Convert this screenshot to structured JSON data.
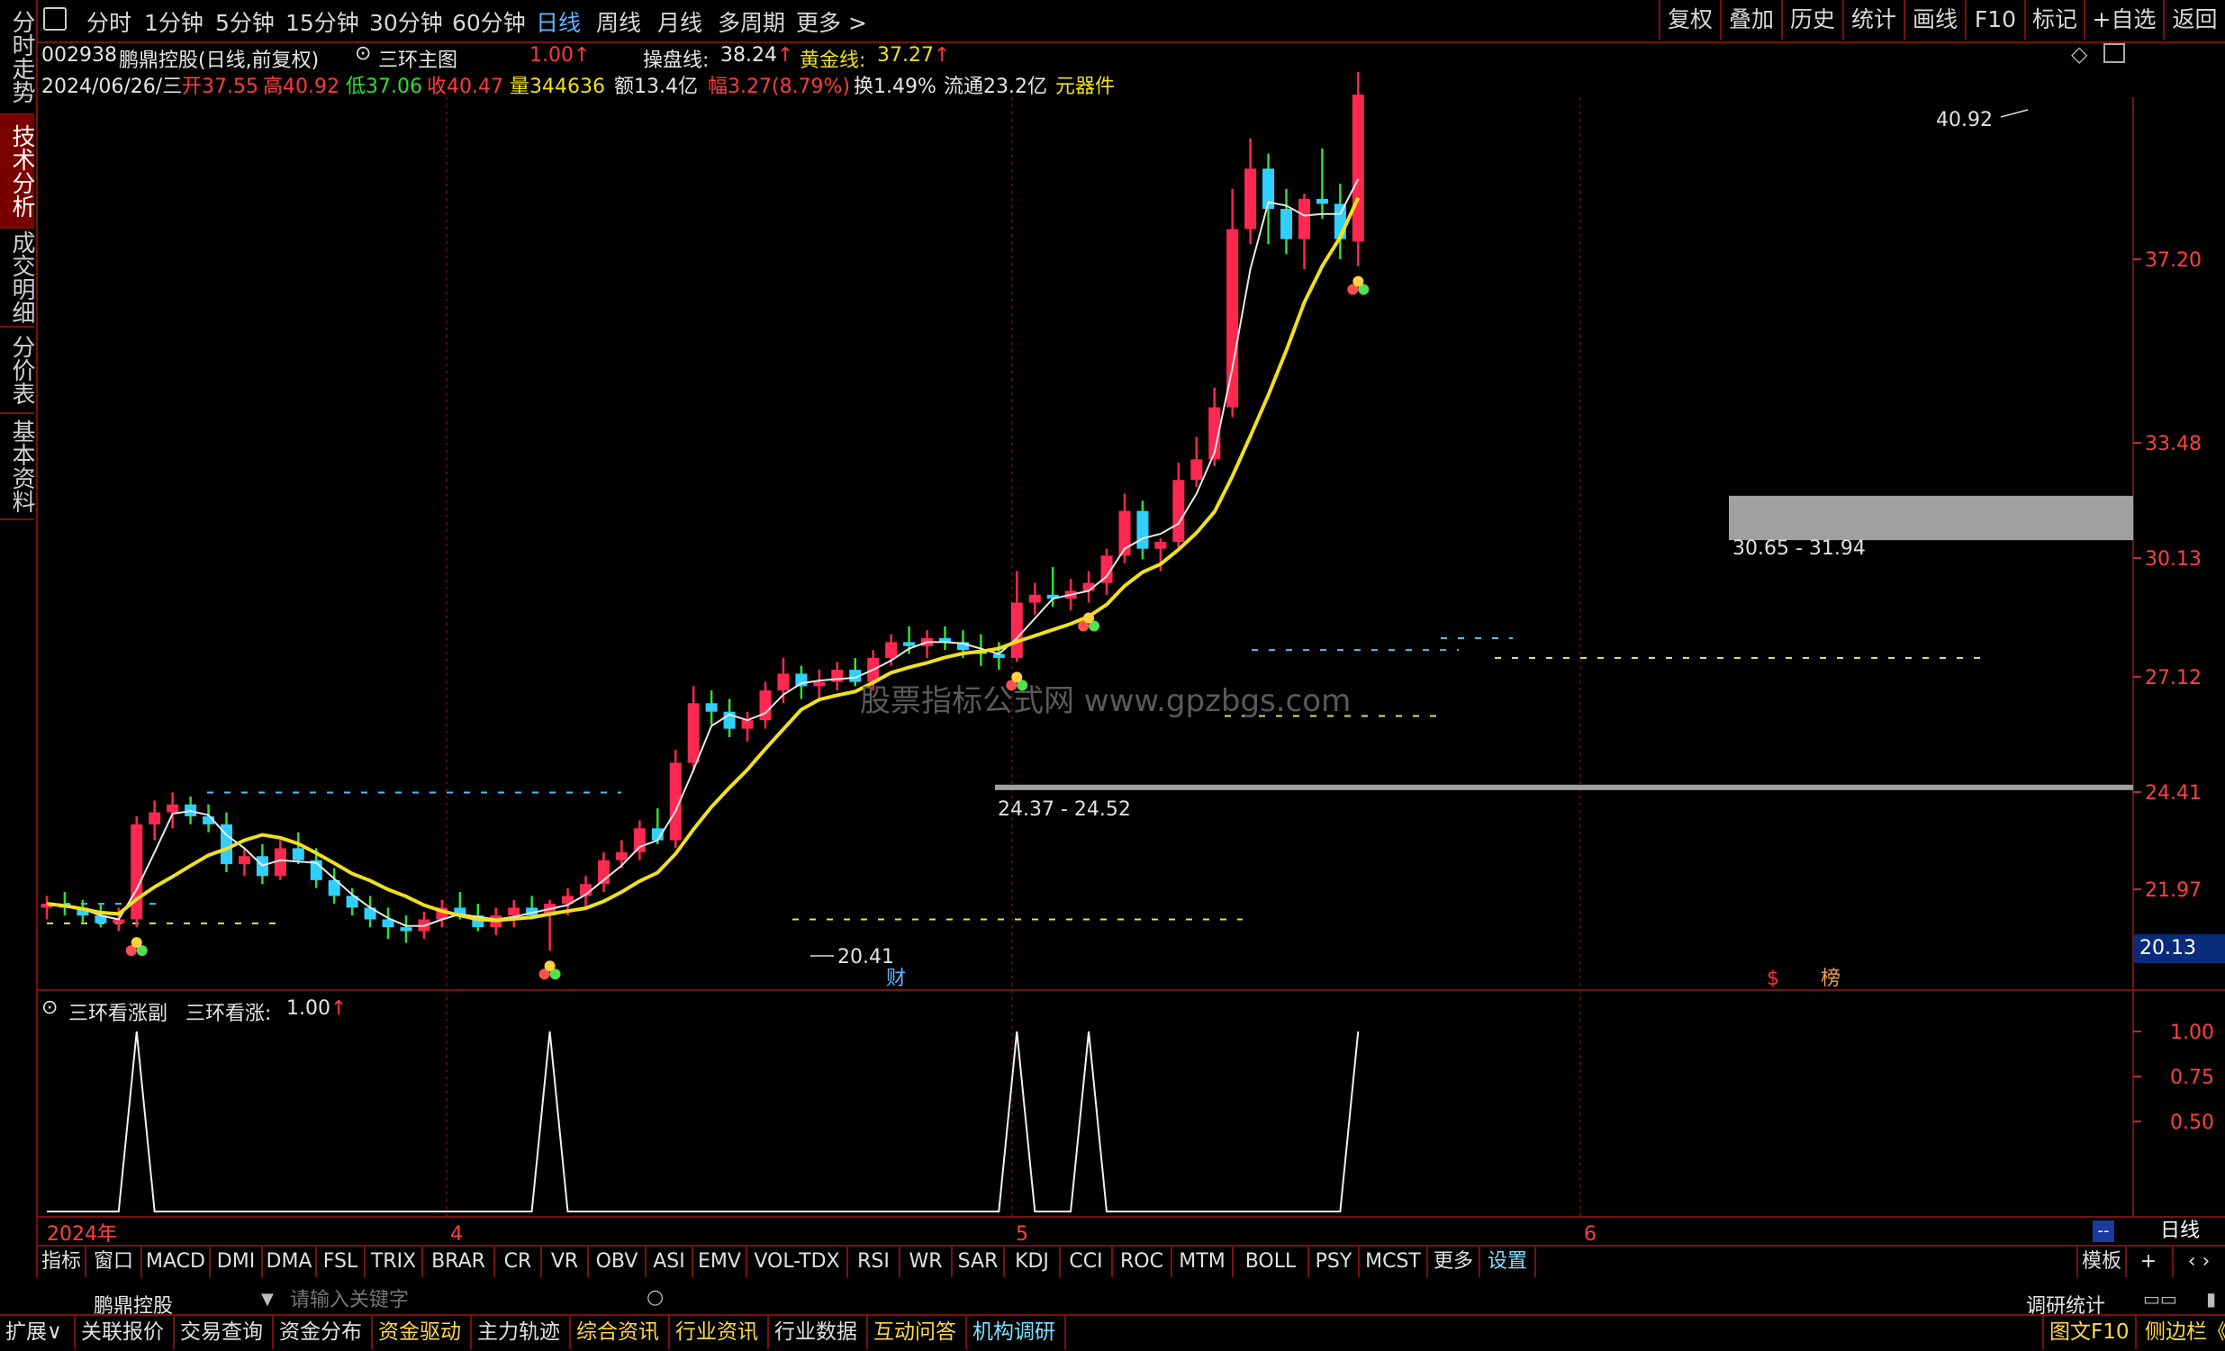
{
  "left_tabs": [
    "分时走势",
    "技术分析",
    "成交明细",
    "分价表",
    "基本资料"
  ],
  "active_left_tab": 1,
  "periods": [
    "分时",
    "1分钟",
    "5分钟",
    "15分钟",
    "30分钟",
    "60分钟",
    "日线",
    "周线",
    "月线",
    "多周期",
    "更多"
  ],
  "active_period": 6,
  "right_buttons": [
    "复权",
    "叠加",
    "历史",
    "统计",
    "画线",
    "F10",
    "标记",
    "+自选",
    "返回"
  ],
  "header": {
    "code": "002938",
    "name_info": "鹏鼎控股(日线,前复权)",
    "indicator": "三环主图",
    "indicator_value": "1.00",
    "line1_label": "操盘线:",
    "line1_value": "38.24",
    "line2_label": "黄金线:",
    "line2_value": "37.27"
  },
  "quote": {
    "date": "2024/06/26/三",
    "open": "开37.55",
    "high": "高40.92",
    "low": "低37.06",
    "close": "收40.47",
    "volume": "量344636",
    "amount": "额13.4亿",
    "change": "幅3.27(8.79%)",
    "turnover": "换1.49%",
    "float": "流通23.2亿",
    "sector": "元器件"
  },
  "chart_data": {
    "type": "candlestick",
    "price_axis_ticks": [
      "40.92",
      "37.20",
      "33.48",
      "30.13",
      "27.12",
      "24.41",
      "21.97"
    ],
    "current_price_tag": "20.13",
    "annotations": {
      "high_mark": "40.92",
      "low_mark": "20.41",
      "zone_upper": "30.65 - 31.94",
      "zone_lower": "24.37 - 24.52",
      "cai_badge": "财",
      "s_badge": "$",
      "bang_badge": "榜"
    },
    "month_labels": [
      "2024年",
      "4",
      "5",
      "6"
    ],
    "candles": [
      [
        21.5,
        21.8,
        21.2,
        21.6
      ],
      [
        21.6,
        21.9,
        21.3,
        21.5
      ],
      [
        21.5,
        21.7,
        21.1,
        21.3
      ],
      [
        21.3,
        21.6,
        21.0,
        21.1
      ],
      [
        21.1,
        21.5,
        20.9,
        21.2
      ],
      [
        21.2,
        23.8,
        21.0,
        23.6
      ],
      [
        23.6,
        24.2,
        23.2,
        23.9
      ],
      [
        23.9,
        24.4,
        23.5,
        24.1
      ],
      [
        24.1,
        24.3,
        23.6,
        23.8
      ],
      [
        23.8,
        24.1,
        23.4,
        23.6
      ],
      [
        23.6,
        23.9,
        22.4,
        22.6
      ],
      [
        22.6,
        23.0,
        22.3,
        22.8
      ],
      [
        22.8,
        23.1,
        22.1,
        22.3
      ],
      [
        22.3,
        23.2,
        22.2,
        23.0
      ],
      [
        23.0,
        23.4,
        22.6,
        22.7
      ],
      [
        22.7,
        23.0,
        22.0,
        22.2
      ],
      [
        22.2,
        22.5,
        21.6,
        21.8
      ],
      [
        21.8,
        22.0,
        21.3,
        21.5
      ],
      [
        21.5,
        21.8,
        21.0,
        21.2
      ],
      [
        21.2,
        21.5,
        20.7,
        21.0
      ],
      [
        21.0,
        21.3,
        20.6,
        20.9
      ],
      [
        20.9,
        21.4,
        20.7,
        21.2
      ],
      [
        21.2,
        21.7,
        21.0,
        21.5
      ],
      [
        21.5,
        21.9,
        21.2,
        21.3
      ],
      [
        21.3,
        21.6,
        20.9,
        21.0
      ],
      [
        21.0,
        21.5,
        20.8,
        21.3
      ],
      [
        21.3,
        21.7,
        21.0,
        21.5
      ],
      [
        21.5,
        21.8,
        21.2,
        21.3
      ],
      [
        21.3,
        21.7,
        20.4,
        21.6
      ],
      [
        21.6,
        22.0,
        21.3,
        21.8
      ],
      [
        21.8,
        22.3,
        21.5,
        22.1
      ],
      [
        22.1,
        22.9,
        21.9,
        22.7
      ],
      [
        22.7,
        23.2,
        22.5,
        22.9
      ],
      [
        22.9,
        23.7,
        22.7,
        23.5
      ],
      [
        23.5,
        24.0,
        23.1,
        23.2
      ],
      [
        23.2,
        25.4,
        23.0,
        25.1
      ],
      [
        25.1,
        26.9,
        24.9,
        26.5
      ],
      [
        26.5,
        26.8,
        26.0,
        26.3
      ],
      [
        26.3,
        26.6,
        25.7,
        25.9
      ],
      [
        25.9,
        26.3,
        25.6,
        26.1
      ],
      [
        26.1,
        27.0,
        25.9,
        26.8
      ],
      [
        26.8,
        27.6,
        26.5,
        27.2
      ],
      [
        27.2,
        27.4,
        26.6,
        26.9
      ],
      [
        26.9,
        27.3,
        26.6,
        27.0
      ],
      [
        27.0,
        27.5,
        26.8,
        27.3
      ],
      [
        27.3,
        27.6,
        26.9,
        27.0
      ],
      [
        27.0,
        27.8,
        26.8,
        27.6
      ],
      [
        27.6,
        28.2,
        27.4,
        28.0
      ],
      [
        28.0,
        28.4,
        27.7,
        27.9
      ],
      [
        27.9,
        28.3,
        27.6,
        28.1
      ],
      [
        28.1,
        28.4,
        27.8,
        28.0
      ],
      [
        28.0,
        28.3,
        27.6,
        27.8
      ],
      [
        27.8,
        28.2,
        27.4,
        27.7
      ],
      [
        27.7,
        28.0,
        27.3,
        27.6
      ],
      [
        27.6,
        29.8,
        27.5,
        29.0
      ],
      [
        29.0,
        29.5,
        28.7,
        29.2
      ],
      [
        29.2,
        29.9,
        28.9,
        29.1
      ],
      [
        29.1,
        29.6,
        28.8,
        29.3
      ],
      [
        29.3,
        29.8,
        29.0,
        29.5
      ],
      [
        29.5,
        30.4,
        29.2,
        30.2
      ],
      [
        30.2,
        32.0,
        30.0,
        31.5
      ],
      [
        31.5,
        31.8,
        30.1,
        30.4
      ],
      [
        30.4,
        30.7,
        29.8,
        30.6
      ],
      [
        30.6,
        32.9,
        30.4,
        32.4
      ],
      [
        32.4,
        33.6,
        32.2,
        33.0
      ],
      [
        33.0,
        34.6,
        32.8,
        34.2
      ],
      [
        34.2,
        38.6,
        34.0,
        37.8
      ],
      [
        37.8,
        39.6,
        37.5,
        39.0
      ],
      [
        39.0,
        39.3,
        37.5,
        38.2
      ],
      [
        38.2,
        38.6,
        37.3,
        37.6
      ],
      [
        37.6,
        38.5,
        37.0,
        38.4
      ],
      [
        38.4,
        39.4,
        38.0,
        38.3
      ],
      [
        38.3,
        38.7,
        37.2,
        37.6
      ],
      [
        37.55,
        40.92,
        37.06,
        40.47
      ]
    ]
  },
  "sub_panel": {
    "title": "三环看涨副",
    "label": "三环看涨:",
    "value": "1.00",
    "ticks": [
      "1.00",
      "0.75",
      "0.50"
    ],
    "signal_candles": [
      5,
      28,
      54,
      58,
      73
    ]
  },
  "bottom_right_tag": "日线",
  "indicator_tabs": [
    "指标",
    "窗口",
    "MACD",
    "DMI",
    "DMA",
    "FSL",
    "TRIX",
    "BRAR",
    "CR",
    "VR",
    "OBV",
    "ASI",
    "EMV",
    "VOL-TDX",
    "RSI",
    "WR",
    "SAR",
    "KDJ",
    "CCI",
    "ROC",
    "MTM",
    "BOLL",
    "PSY",
    "MCST",
    "更多",
    "设置"
  ],
  "indicator_right": [
    "模板",
    "+"
  ],
  "search": {
    "stock_name": "鹏鼎控股",
    "placeholder": "请输入关键字",
    "right_label": "调研统计"
  },
  "status_tabs": [
    "扩展∨",
    "关联报价",
    "交易查询",
    "资金分布",
    "资金驱动",
    "主力轨迹",
    "综合资讯",
    "行业资讯",
    "行业数据",
    "互动问答",
    "机构调研"
  ],
  "status_right": [
    "图文F10",
    "侧边栏《"
  ],
  "watermark": "股票指标公式网 www.gpzbgs.com"
}
